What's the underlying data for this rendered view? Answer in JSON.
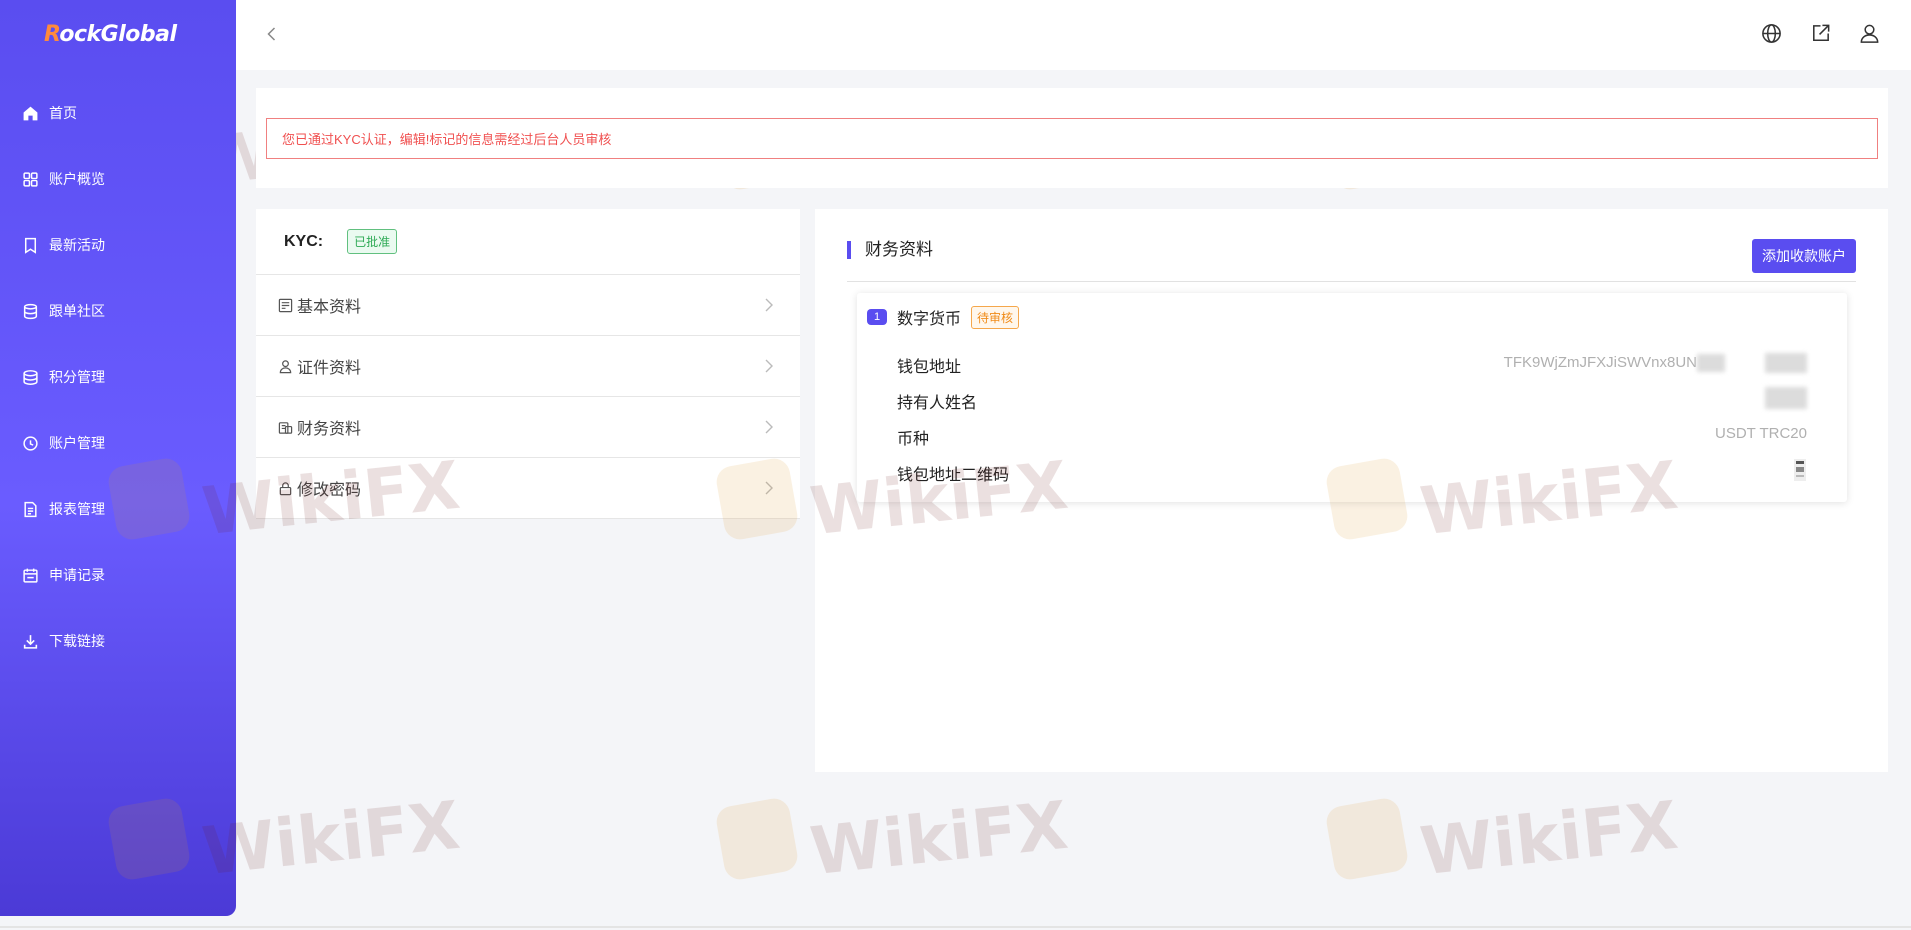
{
  "sidebar": {
    "logo": "RockGlobal",
    "items": [
      {
        "label": "首页",
        "icon": "home-icon"
      },
      {
        "label": "账户概览",
        "icon": "grid-icon"
      },
      {
        "label": "最新活动",
        "icon": "bookmark-icon"
      },
      {
        "label": "跟单社区",
        "icon": "database-icon"
      },
      {
        "label": "积分管理",
        "icon": "coins-icon"
      },
      {
        "label": "账户管理",
        "icon": "clock-icon"
      },
      {
        "label": "报表管理",
        "icon": "document-icon"
      },
      {
        "label": "申请记录",
        "icon": "calendar-icon"
      },
      {
        "label": "下载链接",
        "icon": "download-icon"
      }
    ]
  },
  "header": {
    "icons": [
      "back-icon",
      "globe-icon",
      "share-icon",
      "user-icon"
    ]
  },
  "notice": "您已通过KYC认证，编辑!标记的信息需经过后台人员审核",
  "kyc": {
    "label": "KYC:",
    "status": "已批准",
    "menu": [
      {
        "label": "基本资料",
        "icon": "form-icon"
      },
      {
        "label": "证件资料",
        "icon": "person-icon"
      },
      {
        "label": "财务资料",
        "icon": "finance-icon"
      },
      {
        "label": "修改密码",
        "icon": "lock-icon"
      }
    ]
  },
  "finance": {
    "title": "财务资料",
    "add_button": "添加收款账户",
    "account": {
      "index": "1",
      "name": "数字货币",
      "status": "待审核",
      "fields": [
        {
          "label": "钱包地址",
          "value": "TFK9WjZmJFXJiSWVnx8UN"
        },
        {
          "label": "持有人姓名",
          "value": ""
        },
        {
          "label": "币种",
          "value": "USDT TRC20"
        },
        {
          "label": "钱包地址二维码",
          "value": ""
        }
      ]
    }
  },
  "watermark": "WikiFX",
  "colors": {
    "accent": "#5a4df0",
    "notice_red": "#f05050",
    "approved_green": "#2eaa55",
    "pending_orange": "#f08c1a"
  }
}
